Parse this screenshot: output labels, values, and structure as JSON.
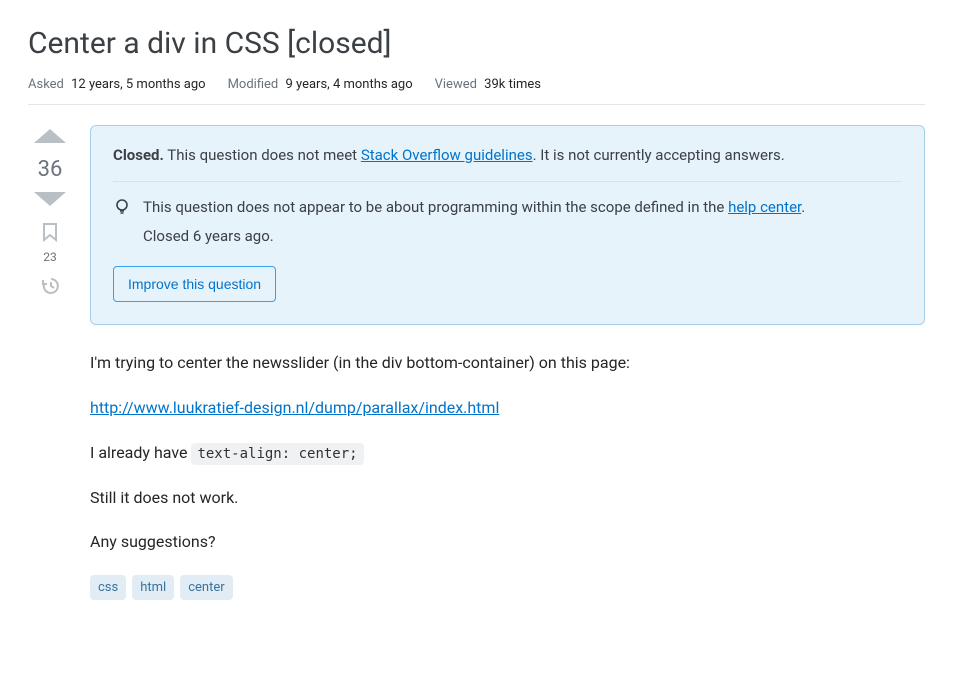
{
  "title": "Center a div in CSS [closed]",
  "meta": {
    "asked_label": "Asked",
    "asked_value": "12 years, 5 months ago",
    "modified_label": "Modified",
    "modified_value": "9 years, 4 months ago",
    "viewed_label": "Viewed",
    "viewed_value": "39k times"
  },
  "vote": {
    "score": "36",
    "bookmark_count": "23"
  },
  "notice": {
    "closed_strong": "Closed.",
    "closed_text_before_link": " This question does not meet ",
    "guidelines_link": "Stack Overflow guidelines",
    "closed_text_after_link": ". It is not currently accepting answers.",
    "detail_before_link": "This question does not appear to be about programming within the scope defined in the ",
    "help_center_link": "help center",
    "detail_after_link": ".",
    "closed_ago": "Closed 6 years ago.",
    "improve_button": "Improve this question"
  },
  "body": {
    "p1": "I'm trying to center the newsslider (in the div bottom-container) on this page:",
    "link_url": "http://www.luukratief-design.nl/dump/parallax/index.html",
    "p2_before_code": "I already have ",
    "p2_code": "text-align: center;",
    "p3": "Still it does not work.",
    "p4": "Any suggestions?"
  },
  "tags": [
    "css",
    "html",
    "center"
  ]
}
